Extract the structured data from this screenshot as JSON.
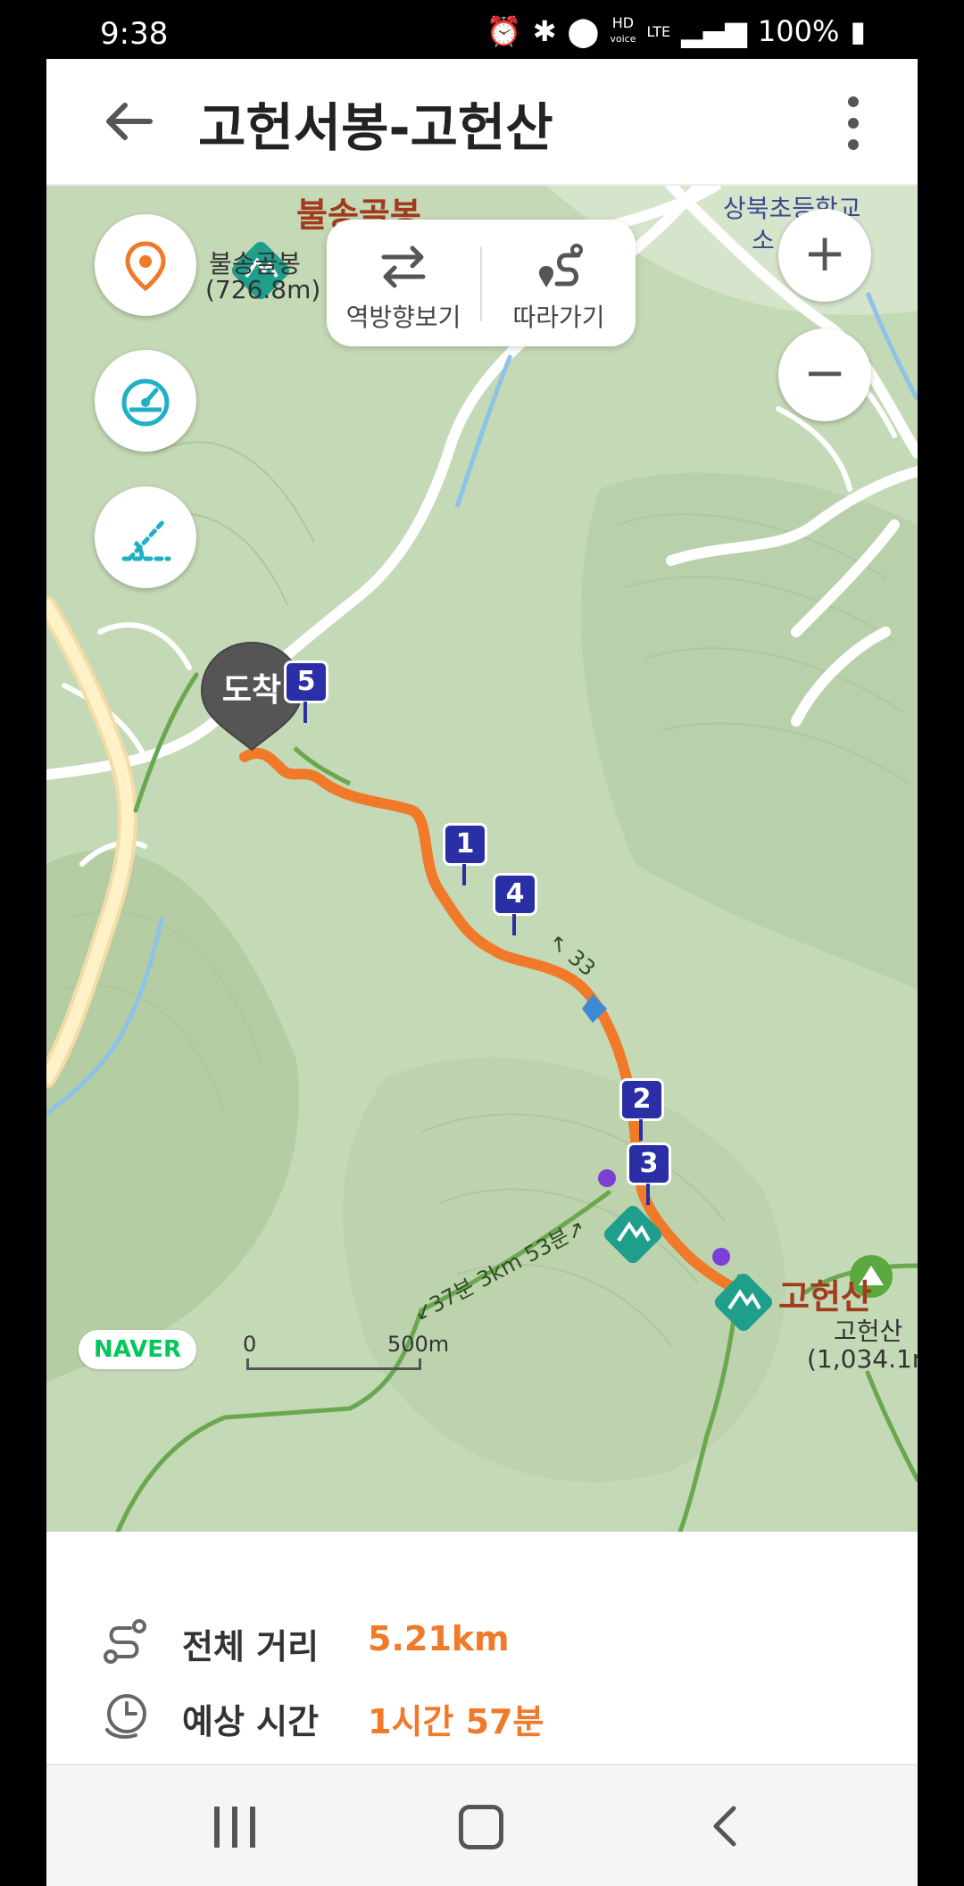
{
  "status_bar": {
    "time": "9:38",
    "battery": "100%",
    "hd_label": "HD",
    "voice_label": "voice",
    "lte_label": "LTE"
  },
  "header": {
    "title": "고헌서봉-고헌산"
  },
  "map": {
    "route_popup": {
      "reverse_label": "역방향보기",
      "follow_label": "따라가기"
    },
    "labels": {
      "peak_bulsong": "불송골봉",
      "peak_bulsong_name": "불송골봉",
      "peak_bulsong_height": "(726.8m)",
      "school": "상북초등학교",
      "school_suffix": "소",
      "peak_goheon": "고헌산",
      "peak_goheon_name": "고헌산",
      "peak_goheon_height": "(1,034.1m",
      "arrive": "도착",
      "trail_time_1": "↙37분 3km 53분↗",
      "trail_time_2": "↖ 33"
    },
    "markers": [
      "1",
      "2",
      "3",
      "4",
      "5"
    ],
    "zoom": {
      "in": "+",
      "out": "−"
    },
    "naver_badge": "NAVER",
    "scale": {
      "start": "0",
      "end": "500m"
    },
    "colors": {
      "route": "#f07a2a",
      "marker": "#2b2fa6",
      "peak_icon": "#1f9e8c"
    }
  },
  "summary": {
    "distance_label": "전체 거리",
    "distance_value": "5.21km",
    "time_label": "예상 시간",
    "time_value": "1시간 57분"
  }
}
